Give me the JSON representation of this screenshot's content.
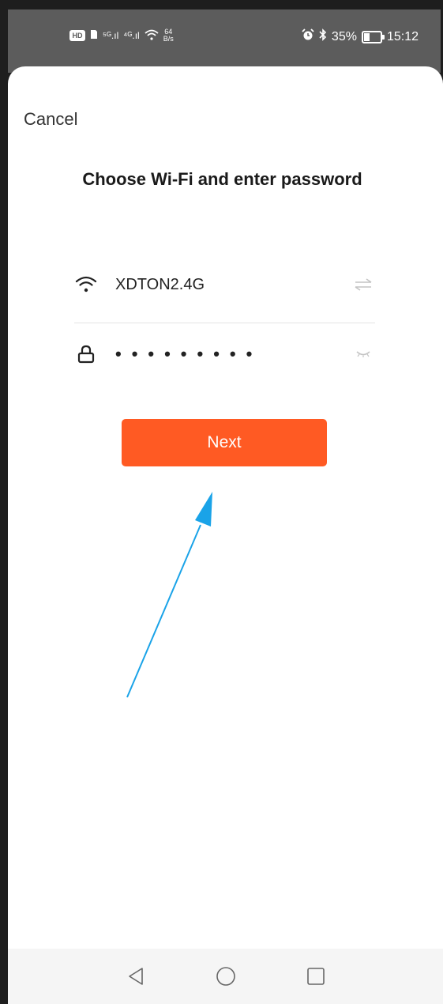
{
  "status_bar": {
    "hd_label": "HD",
    "signal_1": "⁵ᴳ.ıl",
    "signal_2": "⁴ᴳ.ıl",
    "speed_value": "64",
    "speed_unit": "B/s",
    "battery_percent": "35%",
    "time": "15:12"
  },
  "header": {
    "cancel_label": "Cancel",
    "title": "Choose Wi-Fi and enter password"
  },
  "wifi": {
    "icon": "wifi-icon",
    "ssid": "XDTON2.4G",
    "switch_icon": "switch-network-icon"
  },
  "password": {
    "icon": "lock-icon",
    "masked_value": "•••••••••",
    "toggle_icon": "eye-closed-icon"
  },
  "actions": {
    "next_label": "Next"
  },
  "colors": {
    "accent": "#ff5a23",
    "annotation_arrow": "#1aa3e8",
    "status_bar_bg": "#5c5c5c"
  },
  "nav": {
    "back_icon": "back-triangle-icon",
    "home_icon": "home-circle-icon",
    "recents_icon": "recents-square-icon"
  }
}
